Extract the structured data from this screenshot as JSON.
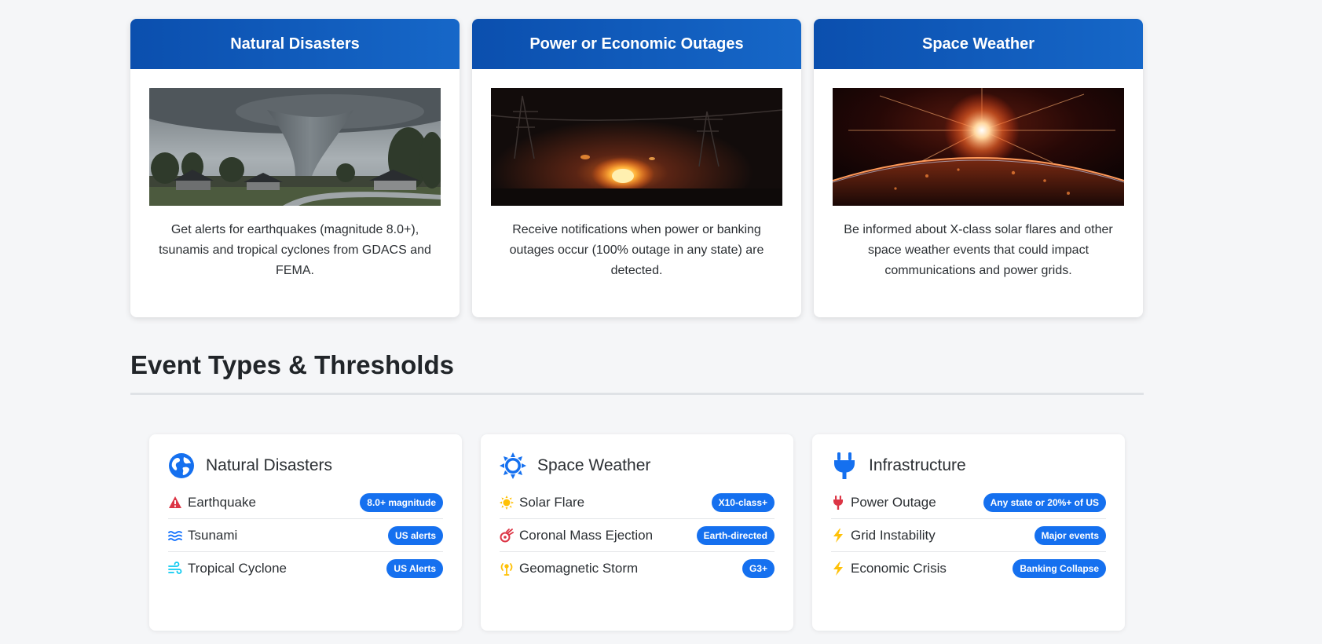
{
  "features": [
    {
      "title": "Natural Disasters",
      "image": "tornado-photo",
      "description": "Get alerts for earthquakes (magnitude 8.0+), tsunamis and tropical cyclones from GDACS and FEMA."
    },
    {
      "title": "Power or Economic Outages",
      "image": "power-outage-fire-photo",
      "description": "Receive notifications when power or banking outages occur (100% outage in any state) are detected."
    },
    {
      "title": "Space Weather",
      "image": "solar-flare-earth-photo",
      "description": "Be informed about X-class solar flares and other space weather events that could impact communications and power grids."
    }
  ],
  "section": {
    "title": "Event Types & Thresholds"
  },
  "event_types": [
    {
      "title": "Natural Disasters",
      "icon": "globe-icon",
      "items": [
        {
          "label": "Earthquake",
          "icon": "warning-triangle-icon",
          "badge": "8.0+ magnitude"
        },
        {
          "label": "Tsunami",
          "icon": "water-waves-icon",
          "badge": "US alerts"
        },
        {
          "label": "Tropical Cyclone",
          "icon": "wind-icon",
          "badge": "US Alerts"
        }
      ]
    },
    {
      "title": "Space Weather",
      "icon": "sun-icon",
      "items": [
        {
          "label": "Solar Flare",
          "icon": "sun-small-icon",
          "badge": "X10-class+"
        },
        {
          "label": "Coronal Mass Ejection",
          "icon": "meteor-icon",
          "badge": "Earth-directed"
        },
        {
          "label": "Geomagnetic Storm",
          "icon": "broadcast-tower-icon",
          "badge": "G3+"
        }
      ]
    },
    {
      "title": "Infrastructure",
      "icon": "plug-icon",
      "items": [
        {
          "label": "Power Outage",
          "icon": "plug-small-icon",
          "badge": "Any state or 20%+ of US"
        },
        {
          "label": "Grid Instability",
          "icon": "lightning-bolt-icon",
          "badge": "Major events"
        },
        {
          "label": "Economic Crisis",
          "icon": "lightning-bolt-icon",
          "badge": "Banking Collapse"
        }
      ]
    }
  ],
  "colors": {
    "header_gradient_start": "#0b4fae",
    "header_gradient_end": "#1667c8",
    "badge": "#1570ef",
    "icon_blue": "#1570ef",
    "warning_red": "#dc3545",
    "tsunami_blue": "#0d6efd",
    "cyclone_teal": "#0dcaf0",
    "sun_yellow": "#ffc107",
    "bolt_yellow": "#ffc107"
  }
}
